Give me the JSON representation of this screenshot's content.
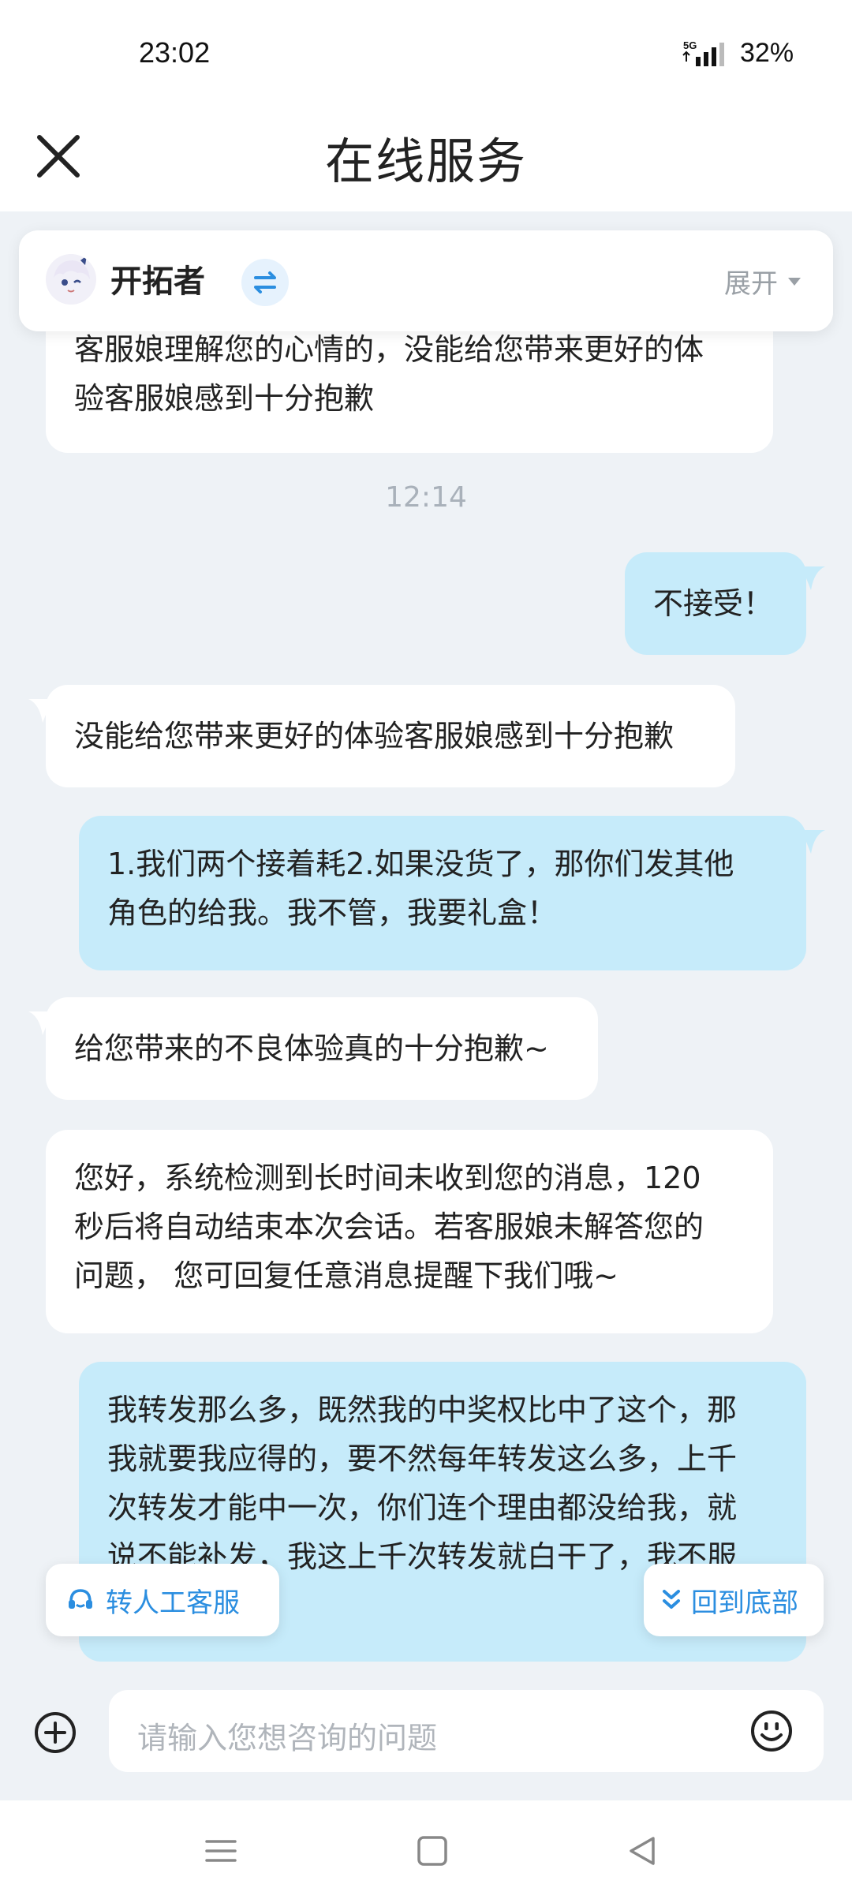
{
  "status_bar": {
    "time": "23:02",
    "battery": "32%",
    "network": "5G"
  },
  "header": {
    "title": "在线服务",
    "close_icon": "close-icon"
  },
  "agent_card": {
    "name": "开拓者",
    "expand_label": "展开",
    "switch_icon": "switch-arrows-icon",
    "avatar_icon": "avatar"
  },
  "messages": [
    {
      "side": "left",
      "text_lines": [
        "客服娘理解您的心情的，没能给您带来更好的体",
        "验客服娘感到十分抱歉"
      ]
    },
    {
      "type": "timestamp",
      "text": "12:14"
    },
    {
      "side": "right",
      "text_lines": [
        "不接受！"
      ]
    },
    {
      "side": "left",
      "text_lines": [
        "没能给您带来更好的体验客服娘感到十分抱歉"
      ]
    },
    {
      "side": "right",
      "text_lines": [
        "1.我们两个接着耗2.如果没货了，那你们发其他",
        "角色的给我。我不管，我要礼盒！"
      ]
    },
    {
      "side": "left",
      "text_lines": [
        "给您带来的不良体验真的十分抱歉~"
      ]
    },
    {
      "side": "left",
      "text_lines": [
        "您好，系统检测到长时间未收到您的消息，120",
        "秒后将自动结束本次会话。若客服娘未解答您的",
        "问题， 您可回复任意消息提醒下我们哦~"
      ]
    },
    {
      "side": "right",
      "text_lines": [
        "我转发那么多，既然我的中奖权比中了这个，那",
        "我就要我应得的，要不然每年转发这么多，上千",
        "次转发才能中一次，你们连个理由都没给我，就",
        "说不能补发，我这上千次转发就白干了，我不服"
      ]
    }
  ],
  "floating_buttons": {
    "human_service": "转人工客服",
    "scroll_bottom": "回到底部"
  },
  "input_bar": {
    "placeholder": "请输入您想咨询的问题",
    "add_icon": "plus-circle-icon",
    "emoji_icon": "smiley-icon"
  },
  "nav_bar": {
    "icons": [
      "menu-icon",
      "home-square-icon",
      "back-triangle-icon"
    ]
  },
  "colors": {
    "background": "#eef2f6",
    "user_bubble": "#c6ebfa",
    "agent_bubble": "#ffffff",
    "accent": "#2b8ee0"
  }
}
